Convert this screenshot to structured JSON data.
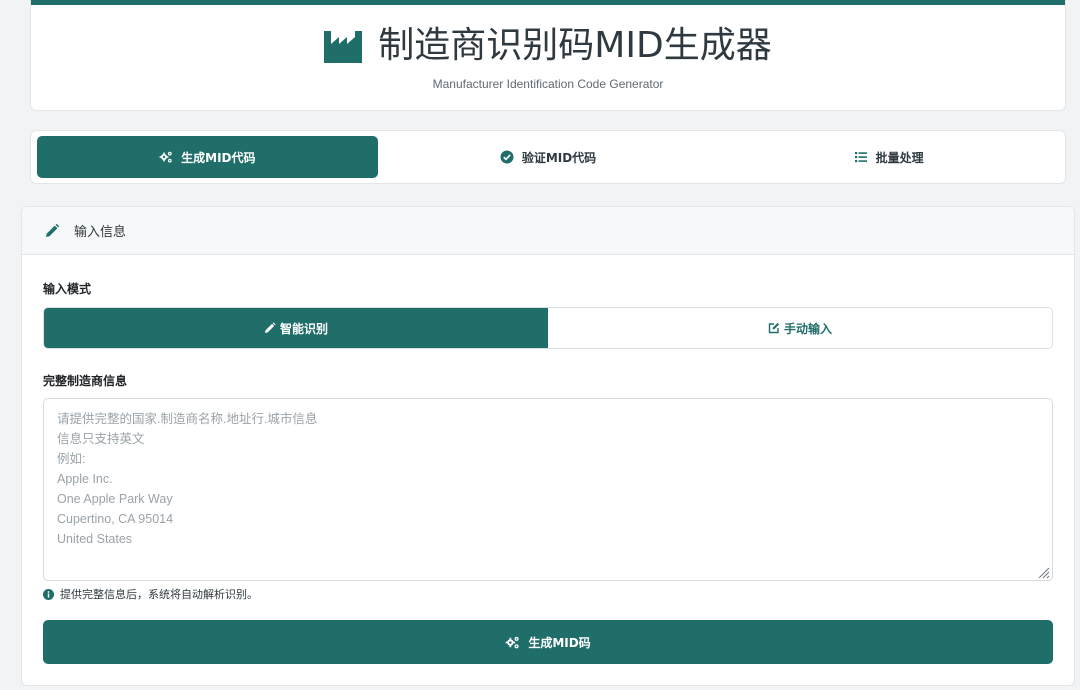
{
  "header": {
    "title": "制造商识别码MID生成器",
    "subtitle": "Manufacturer Identification Code Generator",
    "icon": "factory-icon"
  },
  "tabs": [
    {
      "label": "生成MID代码",
      "icon": "cogs-icon",
      "active": true
    },
    {
      "label": "验证MID代码",
      "icon": "check-circle-icon",
      "active": false
    },
    {
      "label": "批量处理",
      "icon": "list-icon",
      "active": false
    }
  ],
  "main": {
    "heading": "输入信息",
    "heading_icon": "pencil-icon",
    "mode_label": "输入模式",
    "modes": [
      {
        "label": "智能识别",
        "icon": "pencil-icon",
        "active": true
      },
      {
        "label": "手动输入",
        "icon": "edit-square-icon",
        "active": false
      }
    ],
    "info_label": "完整制造商信息",
    "textarea": {
      "value": "",
      "placeholder": "请提供完整的国家.制造商名称.地址行.城市信息\n信息只支持英文\n例如:\nApple Inc.\nOne Apple Park Way\nCupertino, CA 95014\nUnited States"
    },
    "hint": "提供完整信息后，系统将自动解析识别。",
    "hint_icon": "info-circle-icon",
    "generate_label": "生成MID码",
    "generate_icon": "cogs-icon"
  },
  "colors": {
    "primary": "#1f6e6a",
    "background": "#f1f3f5",
    "text": "#2f3a40"
  }
}
